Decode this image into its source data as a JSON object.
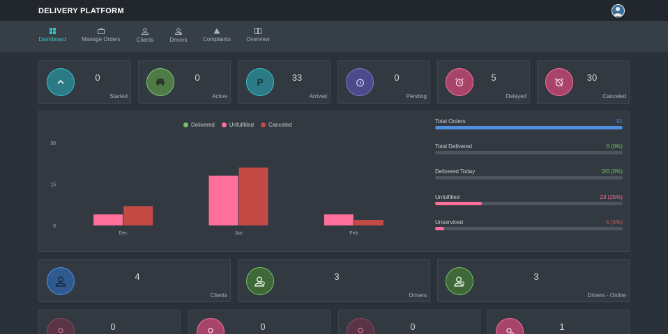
{
  "app": {
    "title": "DELIVERY PLATFORM"
  },
  "nav": [
    {
      "label": "Dashboard",
      "icon": "dashboard-icon"
    },
    {
      "label": "Manage Orders",
      "icon": "briefcase-icon"
    },
    {
      "label": "Clients",
      "icon": "user-icon"
    },
    {
      "label": "Drivers",
      "icon": "driver-icon"
    },
    {
      "label": "Complaints",
      "icon": "warning-icon"
    },
    {
      "label": "Overview",
      "icon": "book-icon"
    }
  ],
  "stats": [
    {
      "value": "0",
      "label": "Started",
      "icon": "chevron-up-icon",
      "color": "#35c3c9"
    },
    {
      "value": "0",
      "label": "Active",
      "icon": "car-icon",
      "color": "#7ccc75"
    },
    {
      "value": "33",
      "label": "Arrived",
      "icon": "parking-icon",
      "color": "#35c3c9"
    },
    {
      "value": "0",
      "label": "Pending",
      "icon": "clock-icon",
      "color": "#7b79c9"
    },
    {
      "value": "5",
      "label": "Delayed",
      "icon": "alarm-icon",
      "color": "#ff6f9c"
    },
    {
      "value": "30",
      "label": "Canceled",
      "icon": "alarm-off-icon",
      "color": "#ff6f9c"
    }
  ],
  "chart_data": {
    "type": "bar",
    "categories": [
      "Dec",
      "Jan",
      "Feb"
    ],
    "series": [
      {
        "name": "Delivered",
        "values": [
          0,
          0,
          0
        ],
        "color": "#74c365"
      },
      {
        "name": "Unfulfilled",
        "values": [
          4,
          18,
          4
        ],
        "color": "#ff6f9c"
      },
      {
        "name": "Canceled",
        "values": [
          7,
          21,
          2
        ],
        "color": "#c44b45"
      }
    ],
    "yticks": [
      "30",
      "15",
      "0"
    ],
    "ylim": [
      0,
      30
    ],
    "legend": "top-center"
  },
  "metrics": [
    {
      "label": "Total Orders",
      "value": "91",
      "fraction": 1.0,
      "color": "#4f8fdf"
    },
    {
      "label": "Total Delivered",
      "value": "0 (0%)",
      "fraction": 0.0,
      "color": "#74c365"
    },
    {
      "label": "Delivered Today",
      "value": "0/0 (0%)",
      "fraction": 0.0,
      "color": "#74c365"
    },
    {
      "label": "Unfulfilled",
      "value": "23 (25%)",
      "fraction": 0.25,
      "color": "#ff6f9c"
    },
    {
      "label": "Unserviced",
      "value": "5 (5%)",
      "fraction": 0.05,
      "color": "#ff6f9c"
    }
  ],
  "people": [
    {
      "value": "4",
      "label": "Clients",
      "icon": "user-icon",
      "color": "#4f8fdf"
    },
    {
      "value": "3",
      "label": "Drivers",
      "icon": "driver-icon",
      "color": "#74c365"
    },
    {
      "value": "3",
      "label": "Drivers - Online",
      "icon": "driver-icon",
      "color": "#74c365"
    }
  ],
  "bottom": [
    {
      "value": "0",
      "icon": "user-icon",
      "color": "#ff6f9c"
    },
    {
      "value": "0",
      "icon": "user-icon",
      "color": "#ff6f9c"
    },
    {
      "value": "0",
      "icon": "user-icon",
      "color": "#ff6f9c"
    },
    {
      "value": "1",
      "icon": "driver-icon",
      "color": "#ff6f9c"
    }
  ]
}
